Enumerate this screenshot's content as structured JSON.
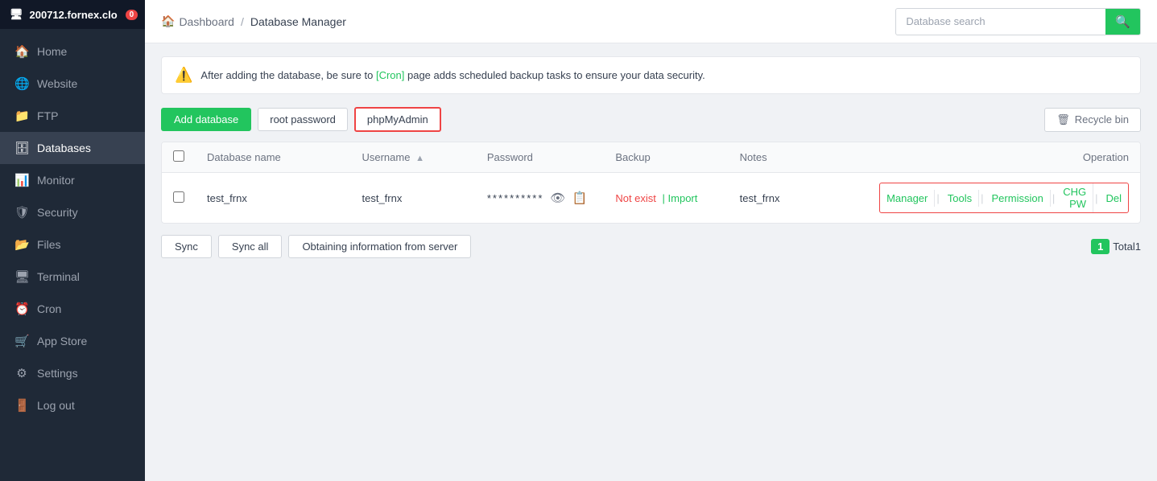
{
  "sidebar": {
    "account": "200712.fornex.clo",
    "badge": "0",
    "items": [
      {
        "id": "home",
        "label": "Home",
        "icon": "🏠",
        "active": false
      },
      {
        "id": "website",
        "label": "Website",
        "icon": "🌐",
        "active": false
      },
      {
        "id": "ftp",
        "label": "FTP",
        "icon": "📁",
        "active": false
      },
      {
        "id": "databases",
        "label": "Databases",
        "icon": "🗄",
        "active": true
      },
      {
        "id": "monitor",
        "label": "Monitor",
        "icon": "📊",
        "active": false
      },
      {
        "id": "security",
        "label": "Security",
        "icon": "🛡",
        "active": false
      },
      {
        "id": "files",
        "label": "Files",
        "icon": "📂",
        "active": false
      },
      {
        "id": "terminal",
        "label": "Terminal",
        "icon": "🖥",
        "active": false
      },
      {
        "id": "cron",
        "label": "Cron",
        "icon": "⏰",
        "active": false
      },
      {
        "id": "appstore",
        "label": "App Store",
        "icon": "🛒",
        "active": false
      },
      {
        "id": "settings",
        "label": "Settings",
        "icon": "⚙",
        "active": false
      },
      {
        "id": "logout",
        "label": "Log out",
        "icon": "🚪",
        "active": false
      }
    ]
  },
  "topbar": {
    "breadcrumb_home": "Dashboard",
    "breadcrumb_sep": "/",
    "breadcrumb_current": "Database Manager",
    "search_placeholder": "Database search"
  },
  "notice": {
    "text_before": "After adding the database, be sure to ",
    "cron_link": "[Cron]",
    "text_after": " page adds scheduled backup tasks to ensure your data security."
  },
  "toolbar": {
    "add_database": "Add database",
    "root_password": "root password",
    "phpmyadmin": "phpMyAdmin",
    "recycle_bin": "Recycle bin"
  },
  "table": {
    "headers": {
      "db_name": "Database name",
      "username": "Username",
      "password": "Password",
      "backup": "Backup",
      "notes": "Notes",
      "operation": "Operation"
    },
    "rows": [
      {
        "db_name": "test_frnx",
        "username": "test_frnx",
        "password": "**********",
        "backup_status": "Not exist",
        "backup_import": "Import",
        "notes": "test_frnx",
        "ops": [
          "Manager",
          "Tools",
          "Permission",
          "CHG PW",
          "Del"
        ]
      }
    ]
  },
  "bottom": {
    "sync": "Sync",
    "sync_all": "Sync all",
    "obtaining_info": "Obtaining information from server",
    "total_count": "1",
    "total_label": "Total1"
  }
}
